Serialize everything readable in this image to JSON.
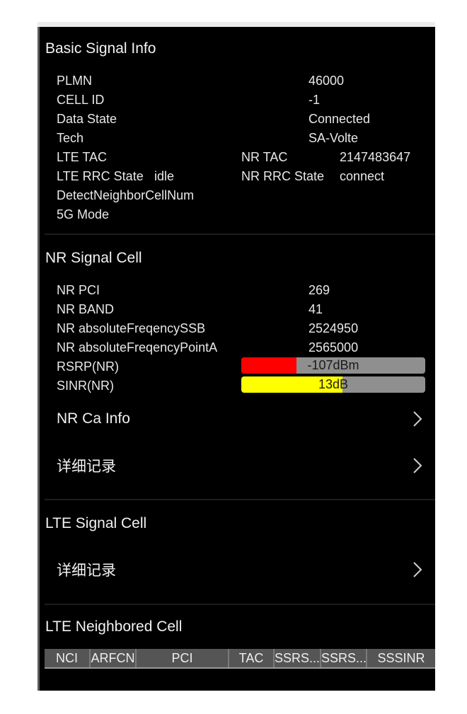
{
  "basic": {
    "title": "Basic Signal Info",
    "rows": [
      {
        "label": "PLMN",
        "value": "46000"
      },
      {
        "label": "CELL ID",
        "value": "-1"
      },
      {
        "label": "Data State",
        "value": "Connected"
      },
      {
        "label": "Tech",
        "value": "SA-Volte"
      }
    ],
    "lte_tac": {
      "label": "LTE TAC",
      "value": ""
    },
    "nr_tac": {
      "label": "NR TAC",
      "value": "2147483647"
    },
    "lte_rrc": {
      "label": "LTE RRC State",
      "value": "idle"
    },
    "nr_rrc": {
      "label": "NR RRC State",
      "value": "connect"
    },
    "detect_neighbor": {
      "label": "DetectNeighborCellNum",
      "value": ""
    },
    "mode_5g": {
      "label": "5G Mode",
      "value": ""
    }
  },
  "nr": {
    "title": "NR Signal Cell",
    "rows": [
      {
        "label": "NR PCI",
        "value": "269"
      },
      {
        "label": "NR BAND",
        "value": "41"
      },
      {
        "label": "NR absoluteFreqencySSB",
        "value": "2524950"
      },
      {
        "label": "NR absoluteFreqencyPointA",
        "value": "2565000"
      }
    ],
    "rsrp": {
      "label": "RSRP(NR)",
      "value_text": "-107dBm",
      "fill_fraction": 0.3,
      "color": "#ff0000"
    },
    "sinr": {
      "label": "SINR(NR)",
      "value_text": "13dB",
      "fill_fraction": 0.55,
      "color": "#ffff00"
    },
    "ca_info_label": "NR Ca Info",
    "detail_label": "详细记录"
  },
  "lte": {
    "title": "LTE Signal Cell",
    "detail_label": "详细记录"
  },
  "neighbor": {
    "title": "LTE Neighbored Cell",
    "columns": [
      "NCI",
      "ARFCN",
      "PCI",
      "TAC",
      "SSRS...",
      "SSRS...",
      "SSSINR"
    ]
  },
  "icons": {
    "chevron": "chevron-right-icon"
  }
}
